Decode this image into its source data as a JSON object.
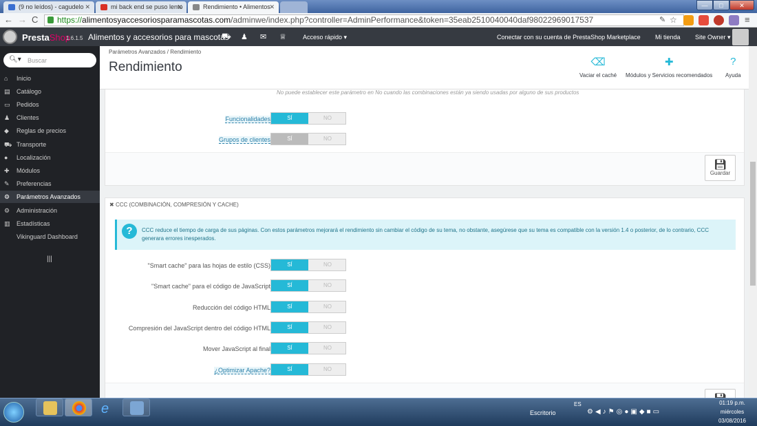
{
  "browser": {
    "tabs": [
      {
        "label": "(9 no leídos) - cagudelo",
        "color": "#3b6fd1"
      },
      {
        "label": "mi back end se puso lento",
        "color": "#d93025"
      },
      {
        "label": "Rendimiento • Alimentos",
        "color": "#888888"
      }
    ],
    "url_https": "https://",
    "url_host": "alimentosyaccesoriosparamascotas.com",
    "url_path": "/adminwe/index.php?controller=AdminPerformance&token=35eab2510040040daf98022969017537"
  },
  "topbar": {
    "brand_main": "Presta",
    "brand_shop": "Shop",
    "version": "1.6.1.5",
    "shop_name": "Alimentos y accesorios para mascotas",
    "quick_access": "Acceso rápido ▾",
    "marketplace": "Conectar con su cuenta de PrestaShop Marketplace",
    "my_shop": "Mi tienda",
    "owner": "Site Owner ▾"
  },
  "sidebar": {
    "search_placeholder": "Buscar",
    "items": [
      {
        "label": "Inicio",
        "icon": "home-icon"
      },
      {
        "label": "Catálogo",
        "icon": "book-icon"
      },
      {
        "label": "Pedidos",
        "icon": "card-icon"
      },
      {
        "label": "Clientes",
        "icon": "users-icon"
      },
      {
        "label": "Reglas de precios",
        "icon": "tag-icon"
      },
      {
        "label": "Transporte",
        "icon": "truck-icon"
      },
      {
        "label": "Localización",
        "icon": "globe-icon"
      },
      {
        "label": "Módulos",
        "icon": "puzzle-icon"
      },
      {
        "label": "Preferencias",
        "icon": "wrench-icon"
      },
      {
        "label": "Parámetros Avanzados",
        "icon": "cogs-icon"
      },
      {
        "label": "Administración",
        "icon": "gear-icon"
      },
      {
        "label": "Estadísticas",
        "icon": "chart-icon"
      },
      {
        "label": "Vikinguard Dashboard",
        "icon": ""
      }
    ],
    "collapse": "|||"
  },
  "header": {
    "breadcrumb": "Parámetros Avanzados  /  Rendimiento",
    "title": "Rendimiento",
    "clear_cache": "Vaciar el caché",
    "modules": "Módulos y Servicios recomendados",
    "help": "Ayuda"
  },
  "combinations_panel": {
    "hint": "No puede establecer este parámetro en No cuando las combinaciones están ya siendo usadas por alguno de sus productos",
    "rows": [
      {
        "label": "Funcionalidades",
        "on": "SÍ",
        "off": "NO"
      },
      {
        "label": "Grupos de clientes",
        "on": "SÍ",
        "off": "NO"
      }
    ],
    "save": "Guardar"
  },
  "ccc_panel": {
    "heading": "CCC (COMBINACIÓN, COMPRESIÓN Y CACHE)",
    "alert": "CCC reduce el tiempo de carga de sus páginas. Con estos parámetros mejorará el rendimiento sin cambiar el código de su tema, no obstante, asegúrese que su tema es compatible con la versión 1.4 o posterior, de lo contrario, CCC generara errores inesperados.",
    "rows": [
      {
        "label": "\"Smart cache\" para las hojas de estilo (CSS)",
        "on": "SÍ",
        "off": "NO"
      },
      {
        "label": "\"Smart cache\" para el código de JavaScript",
        "on": "SÍ",
        "off": "NO"
      },
      {
        "label": "Reducción del código HTML",
        "on": "SÍ",
        "off": "NO"
      },
      {
        "label": "Compresión del JavaScript dentro del código HTML",
        "on": "SÍ",
        "off": "NO"
      },
      {
        "label": "Mover JavaScript al final",
        "on": "SÍ",
        "off": "NO"
      },
      {
        "label": "¿Optimizar Apache?",
        "on": "SÍ",
        "off": "NO"
      }
    ]
  },
  "taskbar": {
    "desktop": "Escritorio",
    "lang": "ES",
    "time": "01:19 p.m.",
    "day": "miércoles",
    "date": "03/08/2016"
  }
}
